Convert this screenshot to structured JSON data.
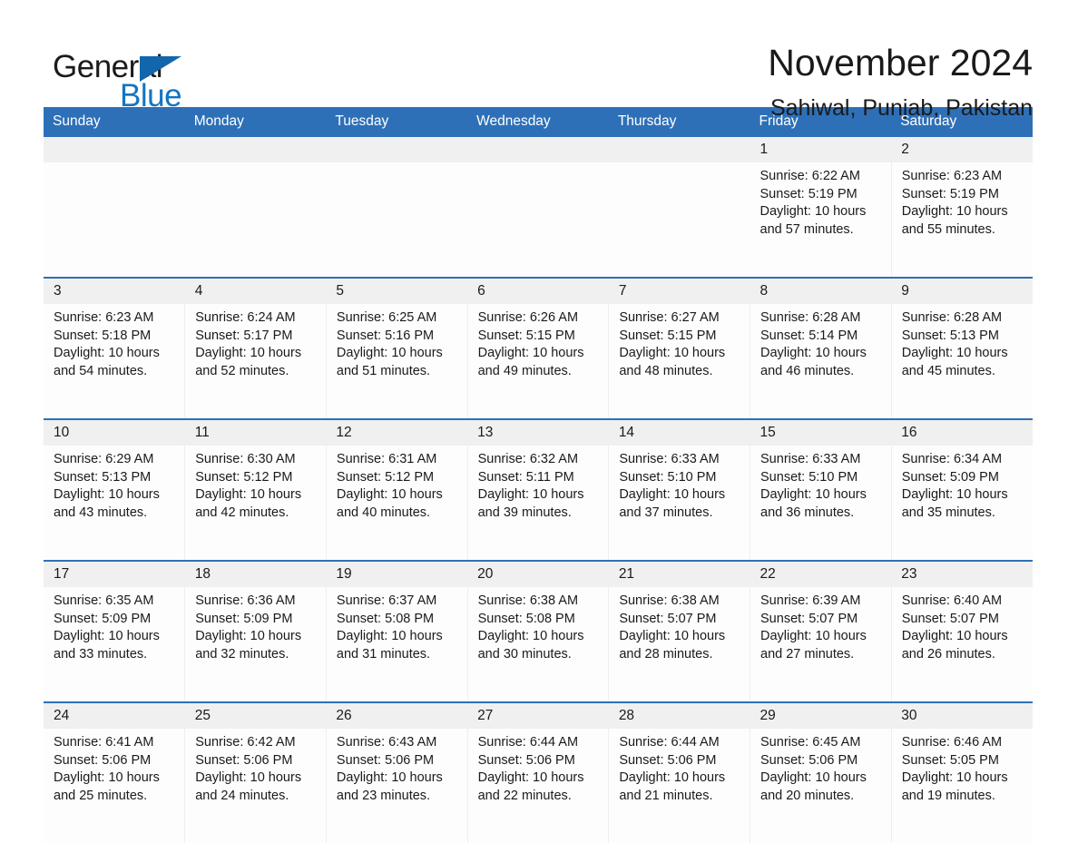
{
  "brand": {
    "name_part1": "General",
    "name_part2": "Blue",
    "logo_icon": "triangle-flag-icon",
    "colors": {
      "black": "#1b1b1b",
      "blue": "#1275c4",
      "triangle": "#1166ac"
    }
  },
  "header": {
    "title": "November 2024",
    "subtitle": "Sahiwal, Punjab, Pakistan"
  },
  "theme": {
    "header_blue": "#2e70b8",
    "daynum_band": "#f0f0f0",
    "cell_background": "#fdfdfd",
    "text": "#1a1a1a"
  },
  "weekdays": [
    "Sunday",
    "Monday",
    "Tuesday",
    "Wednesday",
    "Thursday",
    "Friday",
    "Saturday"
  ],
  "weeks": [
    {
      "days": [
        {
          "num": "",
          "empty": true
        },
        {
          "num": "",
          "empty": true
        },
        {
          "num": "",
          "empty": true
        },
        {
          "num": "",
          "empty": true
        },
        {
          "num": "",
          "empty": true
        },
        {
          "num": "1",
          "sunrise": "Sunrise: 6:22 AM",
          "sunset": "Sunset: 5:19 PM",
          "daylight_1": "Daylight: 10 hours",
          "daylight_2": "and 57 minutes."
        },
        {
          "num": "2",
          "sunrise": "Sunrise: 6:23 AM",
          "sunset": "Sunset: 5:19 PM",
          "daylight_1": "Daylight: 10 hours",
          "daylight_2": "and 55 minutes."
        }
      ]
    },
    {
      "days": [
        {
          "num": "3",
          "sunrise": "Sunrise: 6:23 AM",
          "sunset": "Sunset: 5:18 PM",
          "daylight_1": "Daylight: 10 hours",
          "daylight_2": "and 54 minutes."
        },
        {
          "num": "4",
          "sunrise": "Sunrise: 6:24 AM",
          "sunset": "Sunset: 5:17 PM",
          "daylight_1": "Daylight: 10 hours",
          "daylight_2": "and 52 minutes."
        },
        {
          "num": "5",
          "sunrise": "Sunrise: 6:25 AM",
          "sunset": "Sunset: 5:16 PM",
          "daylight_1": "Daylight: 10 hours",
          "daylight_2": "and 51 minutes."
        },
        {
          "num": "6",
          "sunrise": "Sunrise: 6:26 AM",
          "sunset": "Sunset: 5:15 PM",
          "daylight_1": "Daylight: 10 hours",
          "daylight_2": "and 49 minutes."
        },
        {
          "num": "7",
          "sunrise": "Sunrise: 6:27 AM",
          "sunset": "Sunset: 5:15 PM",
          "daylight_1": "Daylight: 10 hours",
          "daylight_2": "and 48 minutes."
        },
        {
          "num": "8",
          "sunrise": "Sunrise: 6:28 AM",
          "sunset": "Sunset: 5:14 PM",
          "daylight_1": "Daylight: 10 hours",
          "daylight_2": "and 46 minutes."
        },
        {
          "num": "9",
          "sunrise": "Sunrise: 6:28 AM",
          "sunset": "Sunset: 5:13 PM",
          "daylight_1": "Daylight: 10 hours",
          "daylight_2": "and 45 minutes."
        }
      ]
    },
    {
      "days": [
        {
          "num": "10",
          "sunrise": "Sunrise: 6:29 AM",
          "sunset": "Sunset: 5:13 PM",
          "daylight_1": "Daylight: 10 hours",
          "daylight_2": "and 43 minutes."
        },
        {
          "num": "11",
          "sunrise": "Sunrise: 6:30 AM",
          "sunset": "Sunset: 5:12 PM",
          "daylight_1": "Daylight: 10 hours",
          "daylight_2": "and 42 minutes."
        },
        {
          "num": "12",
          "sunrise": "Sunrise: 6:31 AM",
          "sunset": "Sunset: 5:12 PM",
          "daylight_1": "Daylight: 10 hours",
          "daylight_2": "and 40 minutes."
        },
        {
          "num": "13",
          "sunrise": "Sunrise: 6:32 AM",
          "sunset": "Sunset: 5:11 PM",
          "daylight_1": "Daylight: 10 hours",
          "daylight_2": "and 39 minutes."
        },
        {
          "num": "14",
          "sunrise": "Sunrise: 6:33 AM",
          "sunset": "Sunset: 5:10 PM",
          "daylight_1": "Daylight: 10 hours",
          "daylight_2": "and 37 minutes."
        },
        {
          "num": "15",
          "sunrise": "Sunrise: 6:33 AM",
          "sunset": "Sunset: 5:10 PM",
          "daylight_1": "Daylight: 10 hours",
          "daylight_2": "and 36 minutes."
        },
        {
          "num": "16",
          "sunrise": "Sunrise: 6:34 AM",
          "sunset": "Sunset: 5:09 PM",
          "daylight_1": "Daylight: 10 hours",
          "daylight_2": "and 35 minutes."
        }
      ]
    },
    {
      "days": [
        {
          "num": "17",
          "sunrise": "Sunrise: 6:35 AM",
          "sunset": "Sunset: 5:09 PM",
          "daylight_1": "Daylight: 10 hours",
          "daylight_2": "and 33 minutes."
        },
        {
          "num": "18",
          "sunrise": "Sunrise: 6:36 AM",
          "sunset": "Sunset: 5:09 PM",
          "daylight_1": "Daylight: 10 hours",
          "daylight_2": "and 32 minutes."
        },
        {
          "num": "19",
          "sunrise": "Sunrise: 6:37 AM",
          "sunset": "Sunset: 5:08 PM",
          "daylight_1": "Daylight: 10 hours",
          "daylight_2": "and 31 minutes."
        },
        {
          "num": "20",
          "sunrise": "Sunrise: 6:38 AM",
          "sunset": "Sunset: 5:08 PM",
          "daylight_1": "Daylight: 10 hours",
          "daylight_2": "and 30 minutes."
        },
        {
          "num": "21",
          "sunrise": "Sunrise: 6:38 AM",
          "sunset": "Sunset: 5:07 PM",
          "daylight_1": "Daylight: 10 hours",
          "daylight_2": "and 28 minutes."
        },
        {
          "num": "22",
          "sunrise": "Sunrise: 6:39 AM",
          "sunset": "Sunset: 5:07 PM",
          "daylight_1": "Daylight: 10 hours",
          "daylight_2": "and 27 minutes."
        },
        {
          "num": "23",
          "sunrise": "Sunrise: 6:40 AM",
          "sunset": "Sunset: 5:07 PM",
          "daylight_1": "Daylight: 10 hours",
          "daylight_2": "and 26 minutes."
        }
      ]
    },
    {
      "days": [
        {
          "num": "24",
          "sunrise": "Sunrise: 6:41 AM",
          "sunset": "Sunset: 5:06 PM",
          "daylight_1": "Daylight: 10 hours",
          "daylight_2": "and 25 minutes."
        },
        {
          "num": "25",
          "sunrise": "Sunrise: 6:42 AM",
          "sunset": "Sunset: 5:06 PM",
          "daylight_1": "Daylight: 10 hours",
          "daylight_2": "and 24 minutes."
        },
        {
          "num": "26",
          "sunrise": "Sunrise: 6:43 AM",
          "sunset": "Sunset: 5:06 PM",
          "daylight_1": "Daylight: 10 hours",
          "daylight_2": "and 23 minutes."
        },
        {
          "num": "27",
          "sunrise": "Sunrise: 6:44 AM",
          "sunset": "Sunset: 5:06 PM",
          "daylight_1": "Daylight: 10 hours",
          "daylight_2": "and 22 minutes."
        },
        {
          "num": "28",
          "sunrise": "Sunrise: 6:44 AM",
          "sunset": "Sunset: 5:06 PM",
          "daylight_1": "Daylight: 10 hours",
          "daylight_2": "and 21 minutes."
        },
        {
          "num": "29",
          "sunrise": "Sunrise: 6:45 AM",
          "sunset": "Sunset: 5:06 PM",
          "daylight_1": "Daylight: 10 hours",
          "daylight_2": "and 20 minutes."
        },
        {
          "num": "30",
          "sunrise": "Sunrise: 6:46 AM",
          "sunset": "Sunset: 5:05 PM",
          "daylight_1": "Daylight: 10 hours",
          "daylight_2": "and 19 minutes."
        }
      ]
    }
  ]
}
